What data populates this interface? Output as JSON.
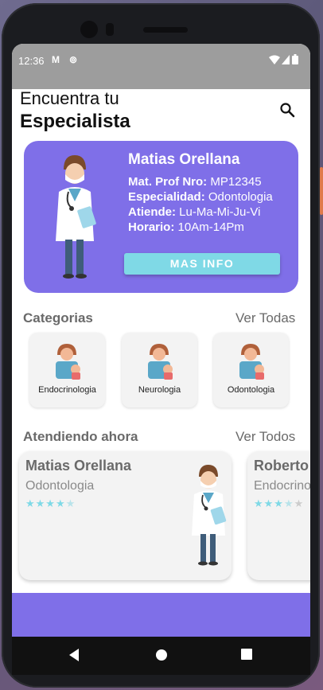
{
  "status": {
    "time": "12:36",
    "icons": [
      "gmail-icon",
      "sync-icon",
      "wifi-icon",
      "signal-icon",
      "battery-icon"
    ]
  },
  "header": {
    "line1": "Encuentra tu",
    "line2": "Especialista"
  },
  "featured": {
    "name": "Matias Orellana",
    "rows": [
      {
        "label": "Mat. Prof Nro:",
        "value": "MP12345"
      },
      {
        "label": "Especialidad:",
        "value": "Odontologia"
      },
      {
        "label": "Atiende:",
        "value": "Lu-Ma-Mi-Ju-Vi"
      },
      {
        "label": "Horario:",
        "value": "10Am-14Pm"
      }
    ],
    "button": "MAS INFO"
  },
  "categories": {
    "title": "Categorias",
    "see_all": "Ver Todas",
    "items": [
      {
        "label": "Endocrinologia"
      },
      {
        "label": "Neurologia"
      },
      {
        "label": "Odontologia"
      }
    ]
  },
  "now": {
    "title": "Atendiendo ahora",
    "see_all": "Ver Todos",
    "cards": [
      {
        "name": "Matias Orellana",
        "specialty": "Odontologia",
        "rating": 4.5
      },
      {
        "name": "Roberto",
        "specialty": "Endocrinologia",
        "rating": 3.5
      }
    ]
  },
  "colors": {
    "accent": "#7f6fe8",
    "button": "#7fd9e6",
    "star": "#7fd9e6"
  }
}
